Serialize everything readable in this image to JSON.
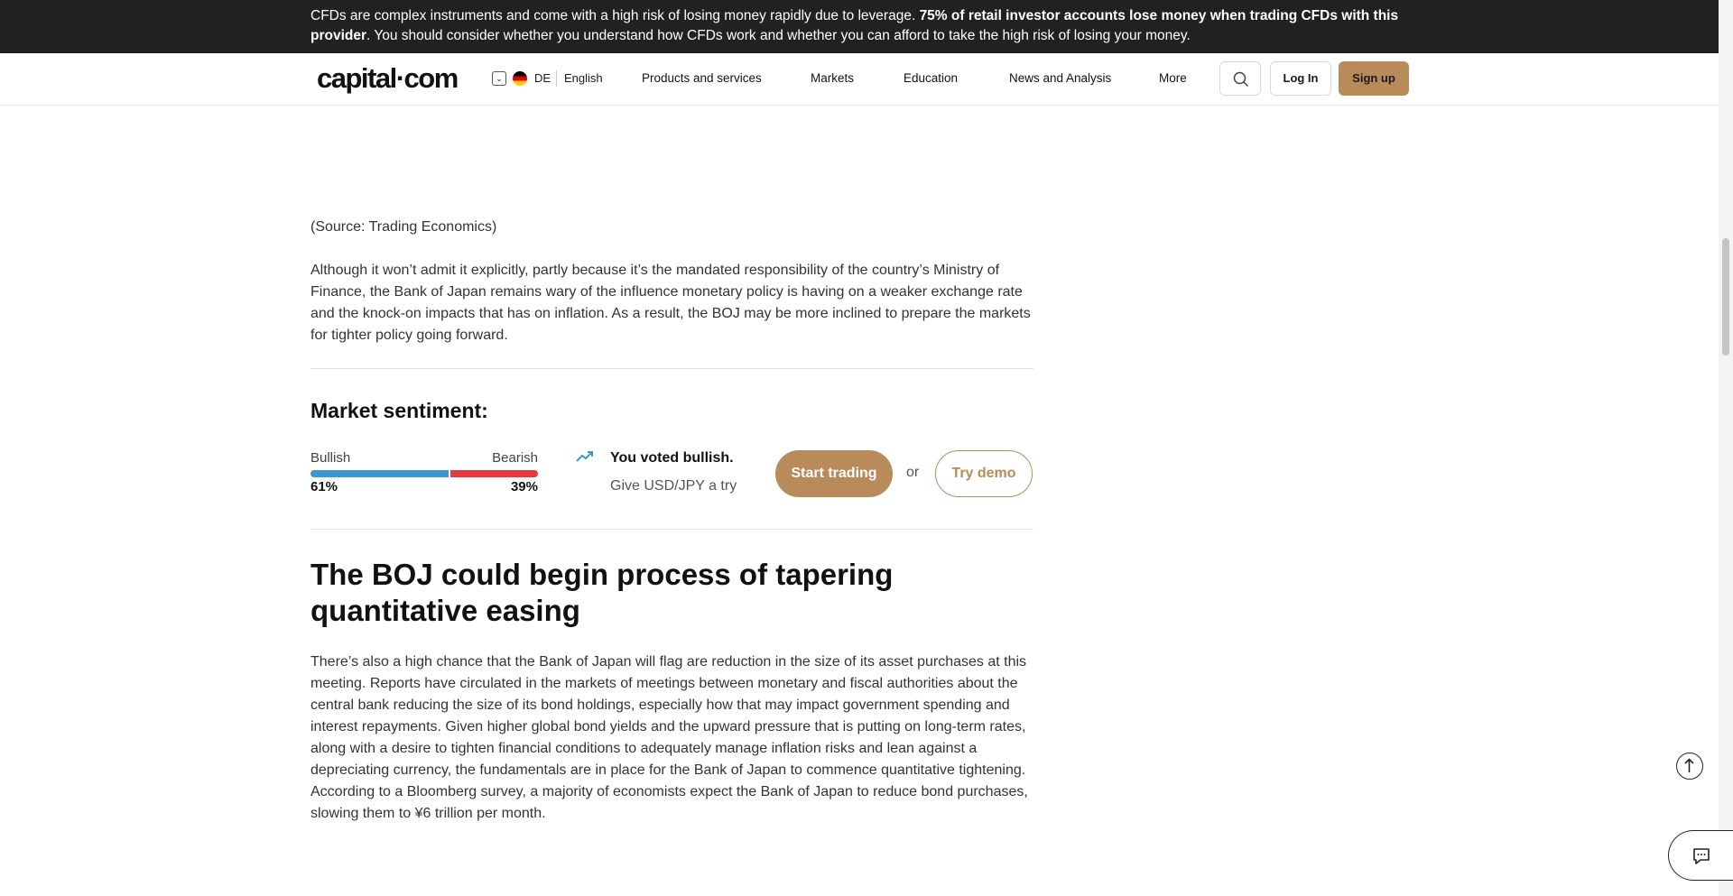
{
  "risk_warning": {
    "text_before": "CFDs are complex instruments and come with a high risk of losing money rapidly due to leverage. ",
    "text_bold": "75% of retail investor accounts lose money when trading CFDs with this provider",
    "text_after": ". You should consider whether you understand how CFDs work and whether you can afford to take the high risk of losing your money."
  },
  "nav": {
    "logo": "capital·com",
    "country": "DE",
    "language": "English",
    "items": [
      "Products and services",
      "Markets",
      "Education",
      "News and Analysis",
      "More"
    ],
    "login_label": "Log In",
    "signup_label": "Sign up",
    "icons": {
      "search": "search-icon",
      "language_dropdown": "chevron-down-icon",
      "flag": "germany-flag-icon"
    }
  },
  "article": {
    "source": "(Source: Trading Economics)",
    "paragraph1": "Although it won’t admit it explicitly, partly because it’s the mandated responsibility of the country’s Ministry of Finance, the Bank of Japan remains wary of the influence monetary policy is having on a weaker exchange rate and the knock-on impacts that has on inflation. As a result, the BOJ may be more inclined to prepare the markets for tighter policy going forward.",
    "heading": "The BOJ could begin process of tapering quantitative easing",
    "paragraph2": "There’s also a high chance that the Bank of Japan will flag are reduction in the size of its asset purchases at this meeting. Reports have circulated in the markets of meetings between monetary and fiscal authorities about the central bank reducing the size of its bond holdings, especially how that may impact government spending and interest repayments. Given higher global bond yields and the upward pressure that is putting on long-term rates, along with a desire to tighten financial conditions to adequately manage inflation risks and lean against a depreciating currency, the fundamentals are in place for the Bank of Japan to commence quantitative tightening. According to a Bloomberg survey, a majority of economists expect the Bank of Japan to reduce bond purchases, slowing them to ¥6 trillion per month."
  },
  "sentiment": {
    "title": "Market sentiment:",
    "bullish_label": "Bullish",
    "bearish_label": "Bearish",
    "bullish_pct_text": "61%",
    "bearish_pct_text": "39%",
    "bullish_fraction": 0.61,
    "vote_text": "You voted bullish.",
    "cta_text": "Give USD/JPY a try",
    "start_label": "Start trading",
    "or_text": "or",
    "demo_label": "Try demo",
    "colors": {
      "bullish": "#3a97cf",
      "bearish": "#e63939",
      "accent": "#b98a5a"
    }
  },
  "floating": {
    "back_to_top": "arrow-up-icon",
    "chat": "chat-icon"
  }
}
